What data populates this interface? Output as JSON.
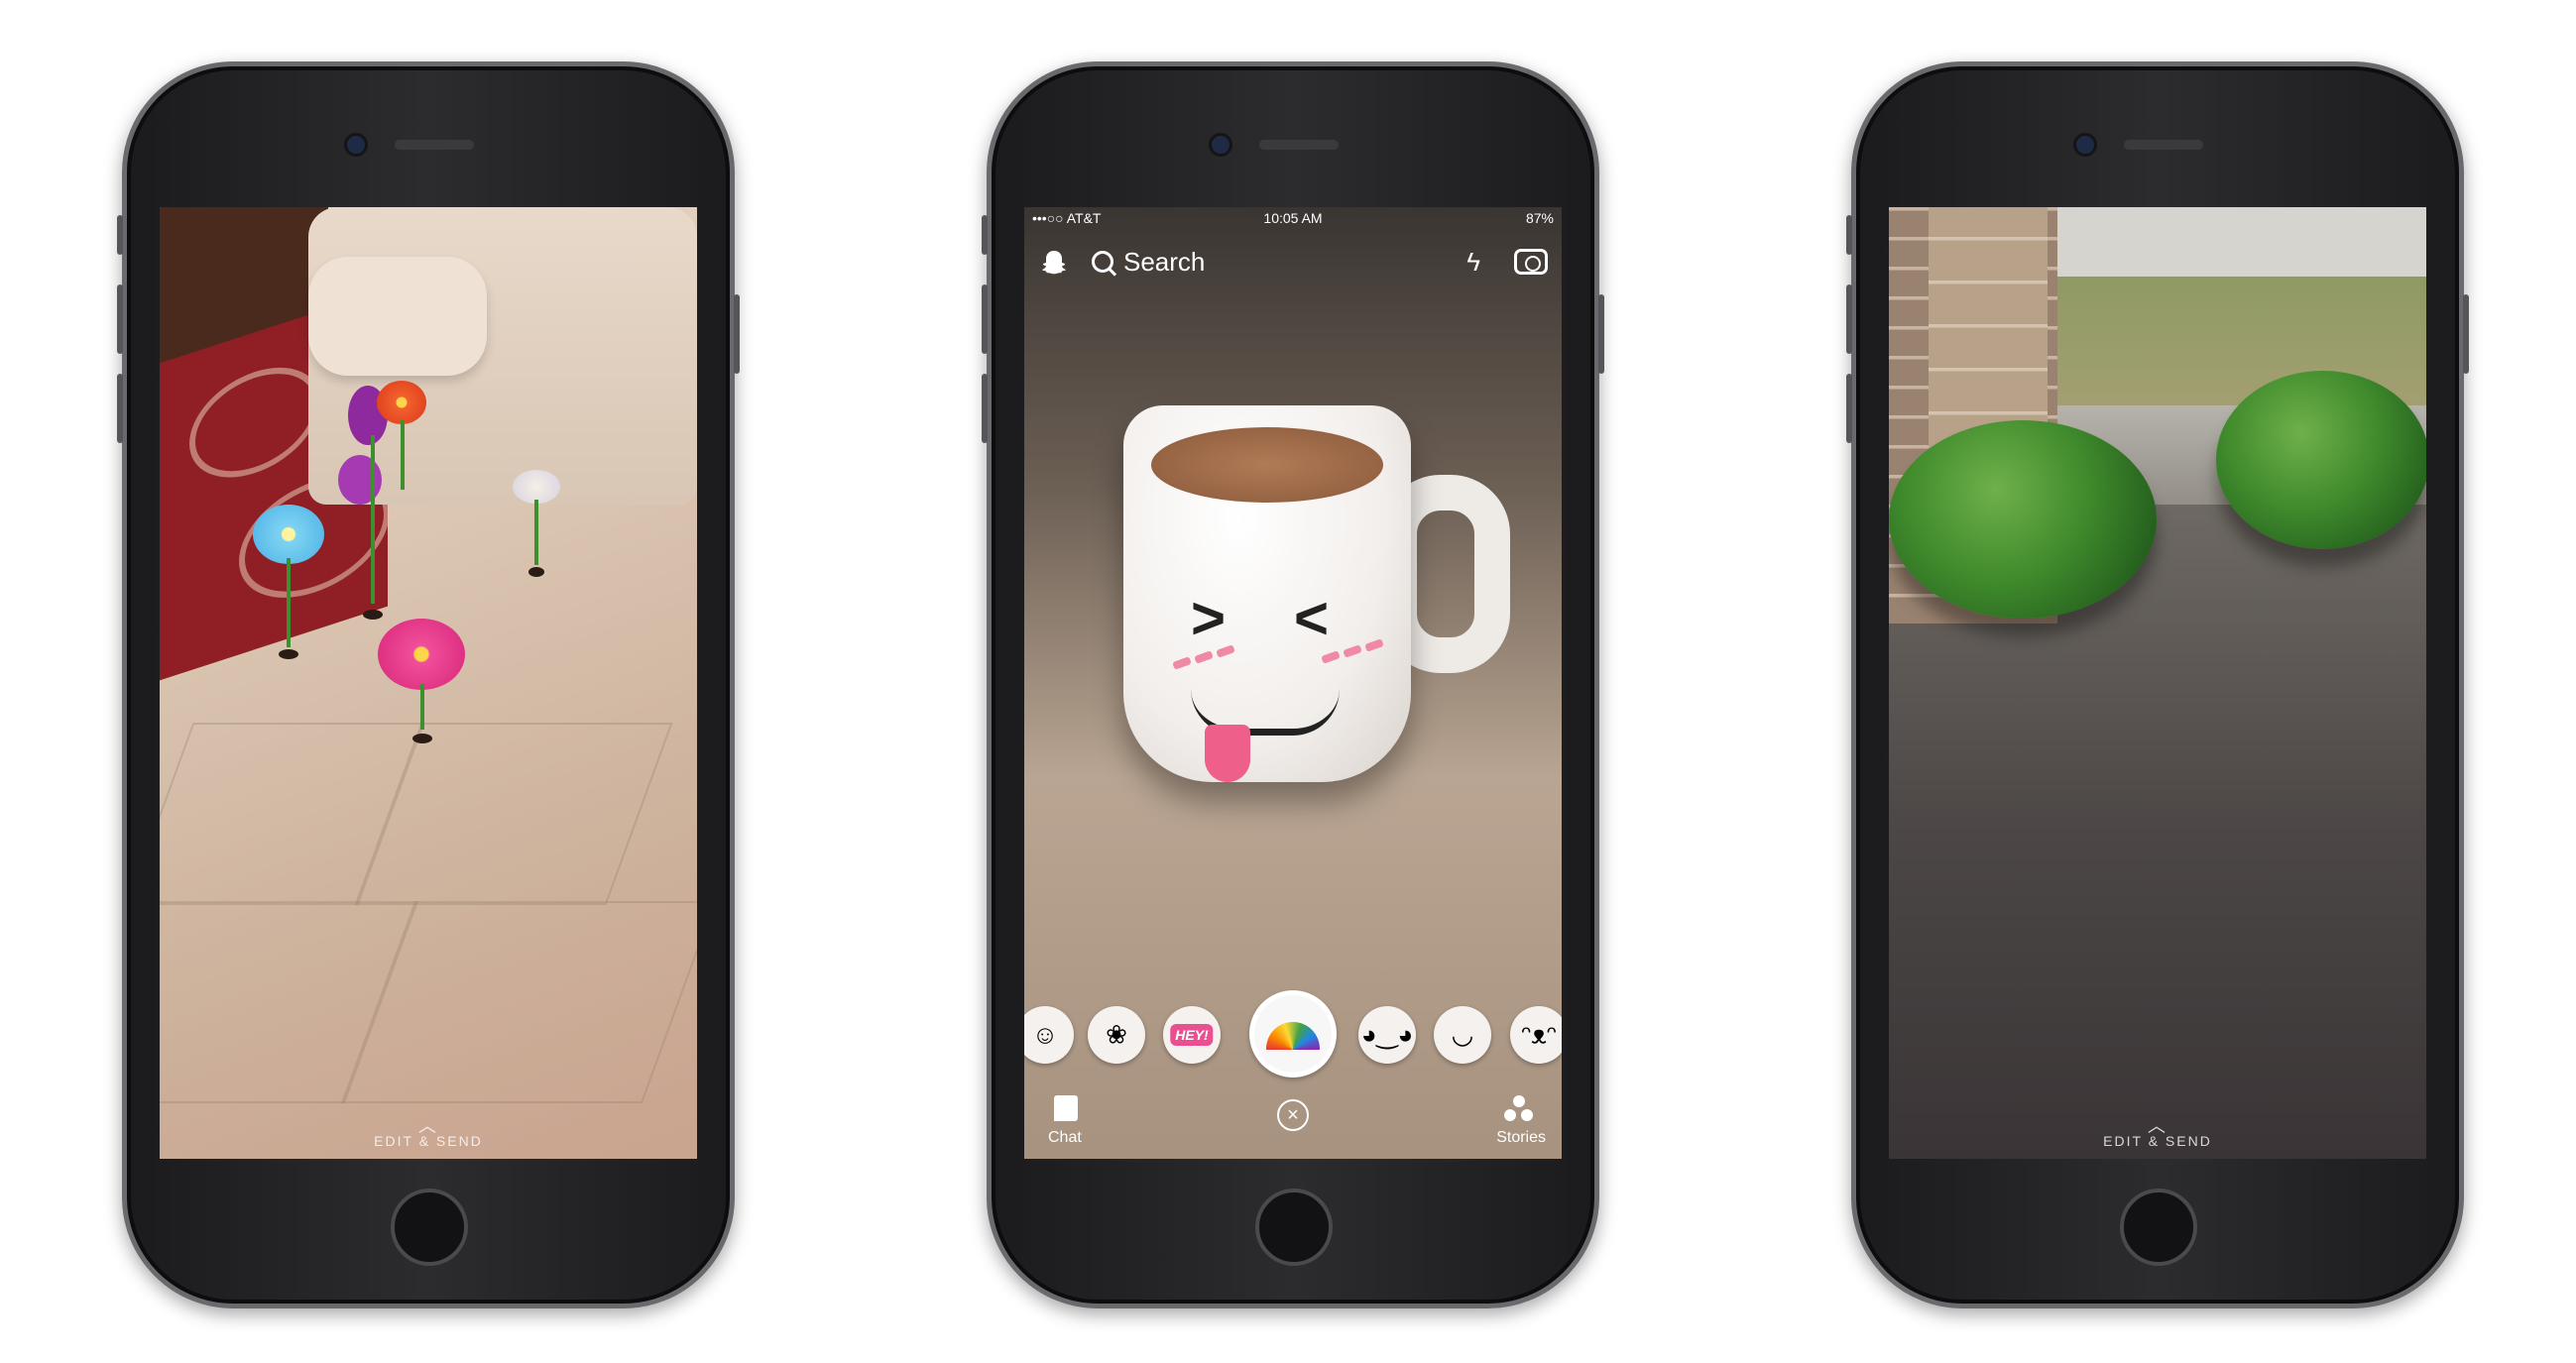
{
  "phones": [
    {
      "id": "left",
      "scene": "AR flowers on tile floor",
      "caption": "EDIT & SEND"
    },
    {
      "id": "middle",
      "scene": "AR mug lens",
      "status": {
        "carrier": "•••○○ AT&T",
        "time": "10:05 AM",
        "battery": "87%"
      },
      "top": {
        "search_label": "Search"
      },
      "lenses": [
        {
          "icon": "girl-face-icon"
        },
        {
          "icon": "flower-crown-face-icon"
        },
        {
          "label": "HEY!",
          "icon": "hey-badge-icon"
        },
        {
          "icon": "rainbow-icon",
          "selected": true
        },
        {
          "icon": "dog-face-icon"
        },
        {
          "icon": "smile-face-icon"
        },
        {
          "icon": "bunny-face-icon"
        }
      ],
      "bottom": {
        "chat_label": "Chat",
        "stories_label": "Stories"
      }
    },
    {
      "id": "right",
      "scene": "AR bushes on porch",
      "caption": "EDIT & SEND"
    }
  ],
  "colors": {
    "phone_body": "#2a2a2d",
    "accent_pink": "#ea4f91"
  }
}
